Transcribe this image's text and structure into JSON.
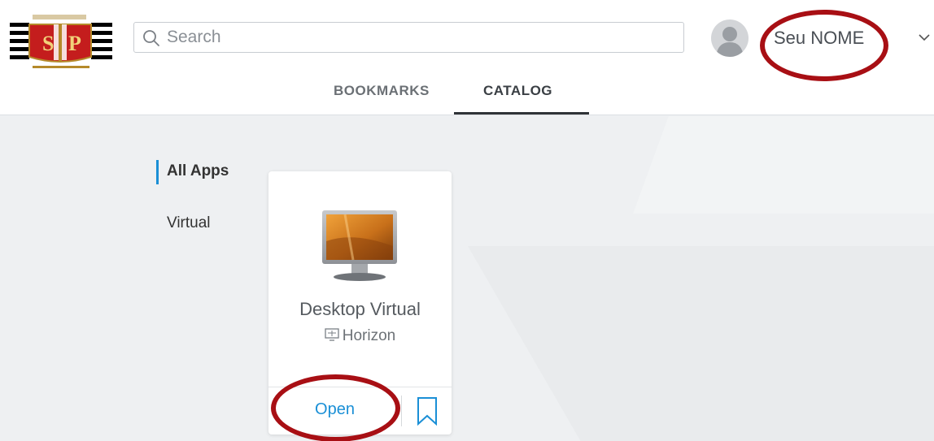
{
  "header": {
    "logo": {
      "alt": "Brasão de São Paulo",
      "emblem_text": "SP"
    },
    "search": {
      "placeholder": "Search",
      "value": ""
    },
    "user": {
      "name": "Seu NOME"
    }
  },
  "tabs": [
    {
      "label": "BOOKMARKS",
      "active": false
    },
    {
      "label": "CATALOG",
      "active": true
    }
  ],
  "sidebar": {
    "categories": [
      {
        "label": "All Apps",
        "active": true
      },
      {
        "label": "Virtual",
        "active": false
      }
    ]
  },
  "apps": [
    {
      "title": "Desktop Virtual",
      "type": "Horizon",
      "open_label": "Open",
      "icon": "desktop-monitor-icon"
    }
  ],
  "colors": {
    "accent": "#1a8fd6",
    "highlight_ring": "#a80f14"
  }
}
